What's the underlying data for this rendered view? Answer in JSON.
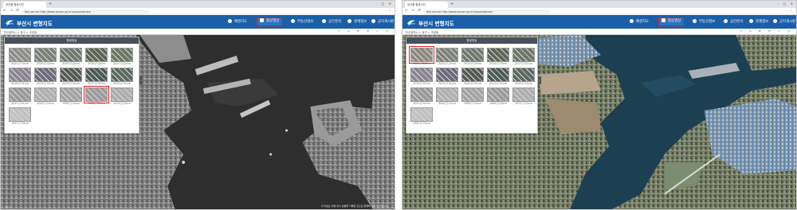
{
  "left": {
    "tab_title": "부산항 항공사진",
    "url": "Not secure  http://www.busan.go.kr/map/airphoto",
    "site_title": "부산시 변형지도",
    "nav": [
      {
        "label": "배경지도",
        "icon": "globe-icon",
        "active": false
      },
      {
        "label": "항공영상",
        "icon": "image-icon",
        "active": true
      },
      {
        "label": "부동산정보",
        "icon": "building-icon",
        "active": false
      },
      {
        "label": "공간분석",
        "icon": "analysis-icon",
        "active": false
      },
      {
        "label": "경계정보",
        "icon": "layers-icon",
        "active": false
      },
      {
        "label": "공지게시판",
        "icon": "board-icon",
        "active": false
      }
    ],
    "breadcrumb": "부산광역시 > 동구 > 초량동",
    "panel_title": "항공영상",
    "years": [
      {
        "label": "2021년 25cm",
        "tone": "#8b8f88"
      },
      {
        "label": "2020년 25cm",
        "tone": "#7d8378"
      },
      {
        "label": "2019년 25cm",
        "tone": "#6f7a6b"
      },
      {
        "label": "2018년 25cm",
        "tone": "#5d6656"
      },
      {
        "label": "2017년 51cm",
        "tone": "#6b7765"
      },
      {
        "label": "2016년 51cm",
        "tone": "#8a8493"
      },
      {
        "label": "2015년 51cm",
        "tone": "#6e6a7a"
      },
      {
        "label": "2014년 51cm",
        "tone": "#565a54"
      },
      {
        "label": "2013년 51cm",
        "tone": "#4e5b55"
      },
      {
        "label": "2012년 51cm",
        "tone": "#5b6a60"
      },
      {
        "label": "2011년 51cm",
        "tone": "#9a9a9a"
      },
      {
        "label": "2005년 25cm",
        "tone": "#b0b0b0"
      },
      {
        "label": "1995년 25cm",
        "tone": "#a4a4a4"
      },
      {
        "label": "1985년 25cm",
        "tone": "#9c9c9c",
        "selected": true
      },
      {
        "label": "1975년 25cm",
        "tone": "#aeaeae"
      },
      {
        "label": "1967년 25cm",
        "tone": "#c2c2c2"
      }
    ],
    "footnote": "이 자료는 촬영 당시 상황을 기록한 것으로 현재와 다를 수 있습니다",
    "scale_label": "100m"
  },
  "right": {
    "tab_title": "부산항 항공사진",
    "url": "Not secure  http://www.busan.go.kr/map/airphoto",
    "site_title": "부산시 변형지도",
    "nav": [
      {
        "label": "배경지도",
        "icon": "globe-icon",
        "active": false
      },
      {
        "label": "항공영상",
        "icon": "image-icon",
        "active": true
      },
      {
        "label": "부동산정보",
        "icon": "building-icon",
        "active": false
      },
      {
        "label": "공간분석",
        "icon": "analysis-icon",
        "active": false
      },
      {
        "label": "경계정보",
        "icon": "layers-icon",
        "active": false
      },
      {
        "label": "공지게시판",
        "icon": "board-icon",
        "active": false
      }
    ],
    "breadcrumb": "부산광역시 > 동구 > 초량동",
    "panel_title": "항공영상",
    "years": [
      {
        "label": "2021년 25cm",
        "tone": "#8c8a80",
        "selected": true
      },
      {
        "label": "2020년 25cm",
        "tone": "#7d8378"
      },
      {
        "label": "2019년 25cm",
        "tone": "#6f7a6b"
      },
      {
        "label": "2018년 25cm",
        "tone": "#5d6656"
      },
      {
        "label": "2017년 51cm",
        "tone": "#6b7765"
      },
      {
        "label": "2016년 51cm",
        "tone": "#8a8493"
      },
      {
        "label": "2015년 51cm",
        "tone": "#6e6a7a"
      },
      {
        "label": "2014년 51cm",
        "tone": "#565a54"
      },
      {
        "label": "2013년 51cm",
        "tone": "#4e5b55"
      },
      {
        "label": "2012년 51cm",
        "tone": "#5b6a60"
      },
      {
        "label": "2011년 51cm",
        "tone": "#9a9a9a"
      },
      {
        "label": "2005년 25cm",
        "tone": "#b0b0b0"
      },
      {
        "label": "1995년 25cm",
        "tone": "#a4a4a4"
      },
      {
        "label": "1985년 25cm",
        "tone": "#9c9c9c"
      },
      {
        "label": "1975년 25cm",
        "tone": "#aeaeae"
      },
      {
        "label": "1967년 25cm",
        "tone": "#c2c2c2"
      }
    ]
  },
  "colors": {
    "header_blue": "#1b5fa8",
    "highlight_red": "#e02020",
    "panel_head": "#47505c",
    "water_gray": "#2a2a2a",
    "water_blue": "#1d3f52"
  }
}
